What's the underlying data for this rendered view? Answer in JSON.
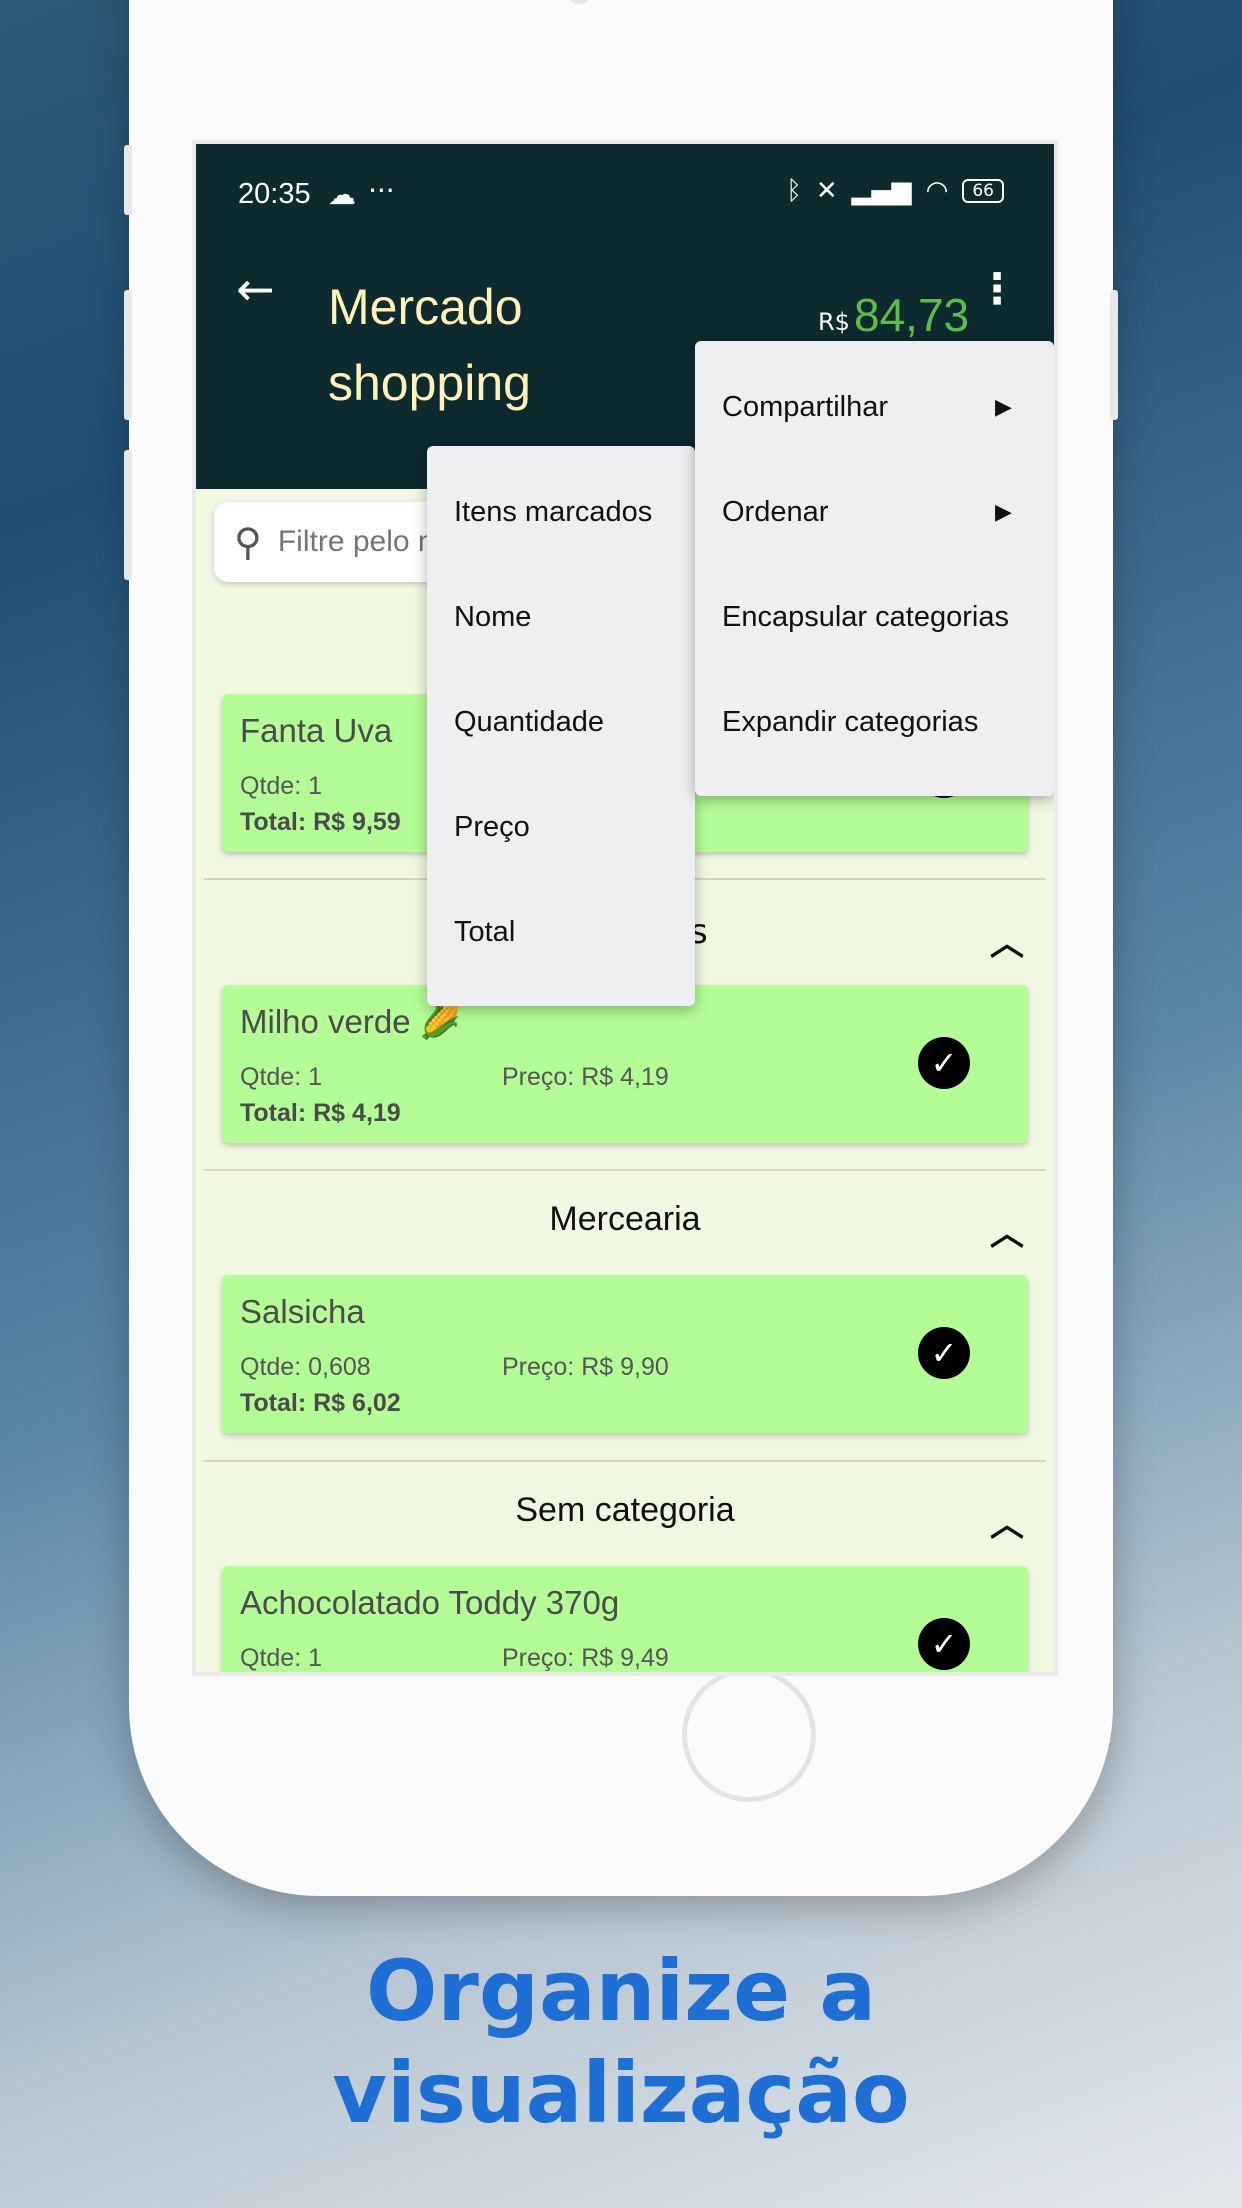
{
  "status_bar": {
    "time": "20:35",
    "cloud_icon": "cloud-icon",
    "dots": "···",
    "battery": "66"
  },
  "appbar": {
    "title": "Mercado shopping",
    "currency": "R$",
    "total": "84,73"
  },
  "search": {
    "placeholder": "Filtre pelo nome"
  },
  "categories": [
    {
      "title": "Mercearia"
    },
    {
      "title": "Sem categoria"
    }
  ],
  "partial_category_tail": "s",
  "items": [
    {
      "name": "Fanta Uva",
      "qty": "Qtde: 1",
      "price": "",
      "total": "Total: R$ 9,59"
    },
    {
      "name": "Milho verde 🌽",
      "qty": "Qtde: 1",
      "price": "Preço: R$ 4,19",
      "total": "Total: R$ 4,19"
    },
    {
      "name": "Salsicha",
      "qty": "Qtde: 0,608",
      "price": "Preço: R$ 9,90",
      "total": "Total: R$ 6,02"
    },
    {
      "name": "Achocolatado Toddy 370g",
      "qty": "Qtde: 1",
      "price": "Preço: R$ 9,49",
      "total": ""
    }
  ],
  "main_menu": [
    "Compartilhar",
    "Ordenar",
    "Encapsular categorias",
    "Expandir categorias"
  ],
  "sort_menu": [
    "Itens marcados",
    "Nome",
    "Quantidade",
    "Preço",
    "Total"
  ],
  "caption": {
    "line1": "Organize a",
    "line2": "visualização"
  },
  "colors": {
    "appbar": "#0d2a2e",
    "card": "#b4fd96",
    "total": "#5cbd4d",
    "caption": "#1d6fd6",
    "title": "#fff2b8"
  }
}
